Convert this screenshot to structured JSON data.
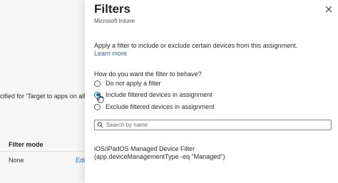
{
  "background": {
    "info_text": "cified for 'Target to apps on all devic",
    "filter_mode_header": "Filter mode",
    "filter_mode_value": "None",
    "edit_link": "Edit"
  },
  "panel": {
    "title": "Filters",
    "subtitle": "Microsoft Intune",
    "description": "Apply a filter to include or exclude certain devices from this assignment.",
    "learn_more": "Learn more",
    "question": "How do you want the filter to behave?",
    "options": [
      {
        "label": "Do not apply a filter",
        "checked": false
      },
      {
        "label": "Include filtered devices in assignment",
        "checked": true
      },
      {
        "label": "Exclude filtered devices in assignment",
        "checked": false
      }
    ],
    "search": {
      "placeholder": "Search by name",
      "value": ""
    },
    "filters": [
      {
        "name": "iOS/iPadOS Managed Device Filter",
        "rule": "(app.deviceManagementType -eq \"Managed\")"
      }
    ]
  },
  "icons": {
    "close": "close-icon",
    "search": "search-icon",
    "cursor": "mouse-pointer-icon"
  },
  "colors": {
    "accent": "#0f6cbd",
    "text": "#2b2b2b"
  }
}
